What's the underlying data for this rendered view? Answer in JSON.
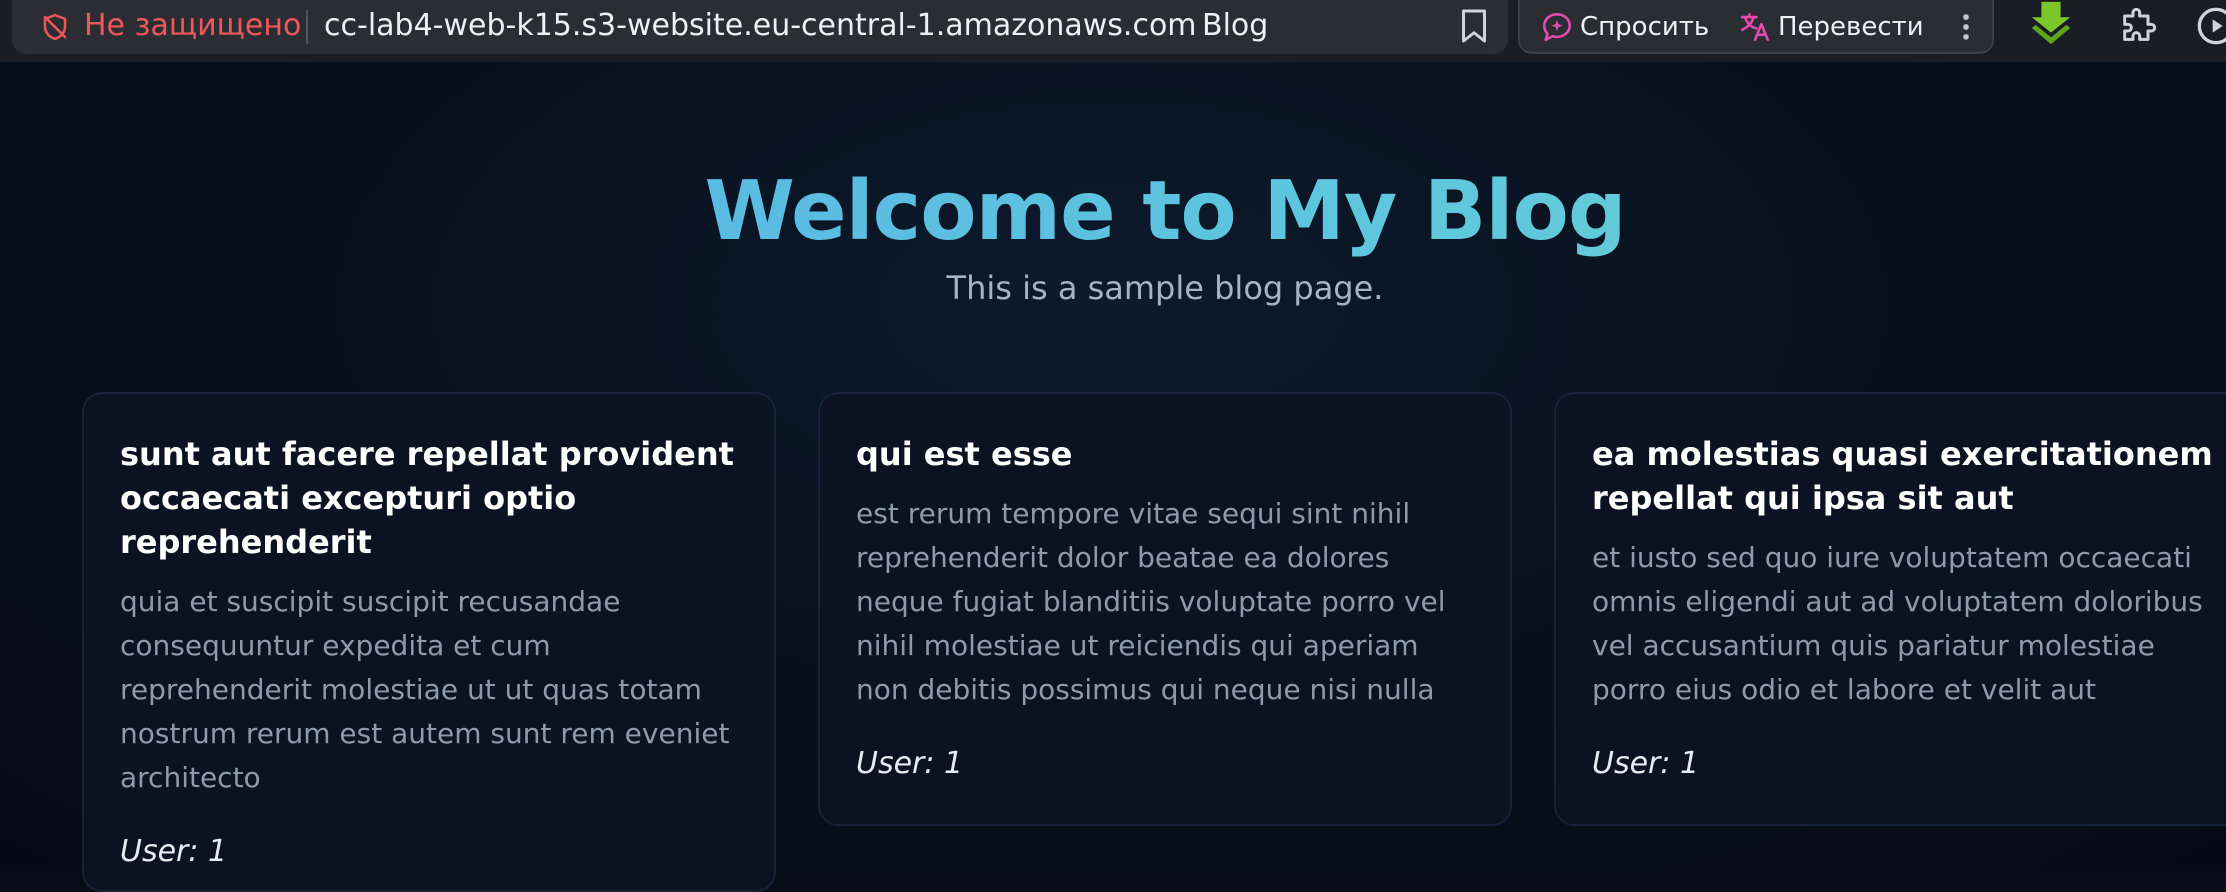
{
  "browser": {
    "security_label": "Не защищено",
    "url": "cc-lab4-web-k15.s3-website.eu-central-1.amazonaws.com",
    "page_title": "Blog",
    "ask_label": "Спросить",
    "translate_label": "Перевести"
  },
  "hero": {
    "title": "Welcome to My Blog",
    "subtitle": "This is a sample blog page."
  },
  "posts": [
    {
      "title": "sunt aut facere repellat provident occaecati excepturi optio reprehenderit",
      "body": "quia et suscipit suscipit recusandae consequuntur expedita et cum reprehenderit molestiae ut ut quas totam nostrum rerum est autem sunt rem eveniet architecto",
      "user": "User: 1"
    },
    {
      "title": "qui est esse",
      "body": "est rerum tempore vitae sequi sint nihil reprehenderit dolor beatae ea dolores neque fugiat blanditiis voluptate porro vel nihil molestiae ut reiciendis qui aperiam non debitis possimus qui neque nisi nulla",
      "user": "User: 1"
    },
    {
      "title": "ea molestias quasi exercitationem repellat qui ipsa sit aut",
      "body": "et iusto sed quo iure voluptatem occaecati omnis eligendi aut ad voluptatem doloribus vel accusantium quis pariatur molestiae porro eius odio et labore et velit aut",
      "user": "User: 1"
    }
  ],
  "icons": {
    "security": "shield-off-icon",
    "bookmark": "bookmark-icon",
    "ask": "ai-chat-icon",
    "translate": "translate-icon",
    "more": "kebab-menu-icon",
    "download": "download-arrow-icon",
    "extensions": "puzzle-icon",
    "media": "media-play-icon"
  },
  "colors": {
    "page_background": "#060d19",
    "insecure_text": "#f0575b",
    "title_gradient_start": "#56aee6",
    "title_gradient_end": "#6fd1c6",
    "card_background": "#0b1322",
    "card_body_text": "#8e9aab",
    "ask_accent": "#e64bb1",
    "download_green": "#7cc72a"
  }
}
